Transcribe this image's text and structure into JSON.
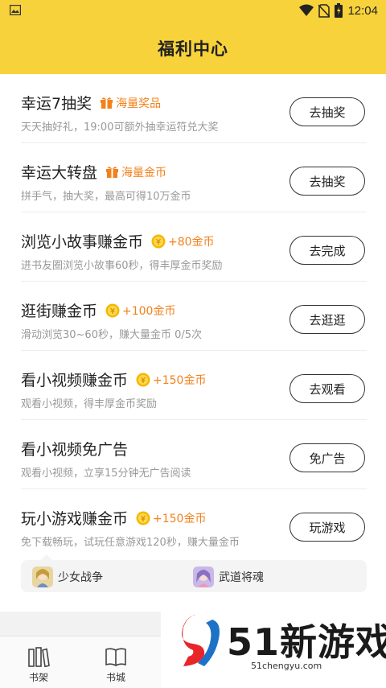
{
  "status_bar": {
    "time": "12:04",
    "icons": [
      "gallery-icon",
      "wifi-icon",
      "no-sim-icon",
      "battery-icon"
    ]
  },
  "header": {
    "title": "福利中心"
  },
  "tasks": [
    {
      "name": "幸运7抽奖",
      "tag": "海量奖品",
      "tag_icon": "gift-icon",
      "desc": "天天抽好礼，19:00可额外抽幸运符兑大奖",
      "button": "去抽奖"
    },
    {
      "name": "幸运大转盘",
      "tag": "海量金币",
      "tag_icon": "gift-icon",
      "desc": "拼手气，抽大奖，最高可得10万金币",
      "button": "去抽奖"
    },
    {
      "name": "浏览小故事赚金币",
      "tag": "+80金币",
      "tag_icon": "coin-icon",
      "desc": "进书友圈浏览小故事60秒，得丰厚金币奖励",
      "button": "去完成"
    },
    {
      "name": "逛街赚金币",
      "tag": "+100金币",
      "tag_icon": "coin-icon",
      "desc": "滑动浏览30~60秒，赚大量金币 0/5次",
      "button": "去逛逛"
    },
    {
      "name": "看小视频赚金币",
      "tag": "+150金币",
      "tag_icon": "coin-icon",
      "desc": "观看小视频，得丰厚金币奖励",
      "button": "去观看"
    },
    {
      "name": "看小视频免广告",
      "tag": "",
      "tag_icon": "",
      "desc": "观看小视频，立享15分钟无广告阅读",
      "button": "免广告"
    },
    {
      "name": "玩小游戏赚金币",
      "tag": "+150金币",
      "tag_icon": "coin-icon",
      "desc": "免下载畅玩，试玩任意游戏120秒，赚大量金币",
      "button": "玩游戏"
    }
  ],
  "games": [
    {
      "name": "少女战争"
    },
    {
      "name": "武道将魂"
    }
  ],
  "bottom_nav": [
    {
      "label": "书架",
      "icon": "bookshelf-icon"
    },
    {
      "label": "书城",
      "icon": "book-icon"
    }
  ],
  "watermark": {
    "text": "51新游戏",
    "url": "51chengyu.com"
  },
  "colors": {
    "accent": "#f8d23a",
    "tag_orange": "#f3811b",
    "coin": "#f5b800"
  }
}
